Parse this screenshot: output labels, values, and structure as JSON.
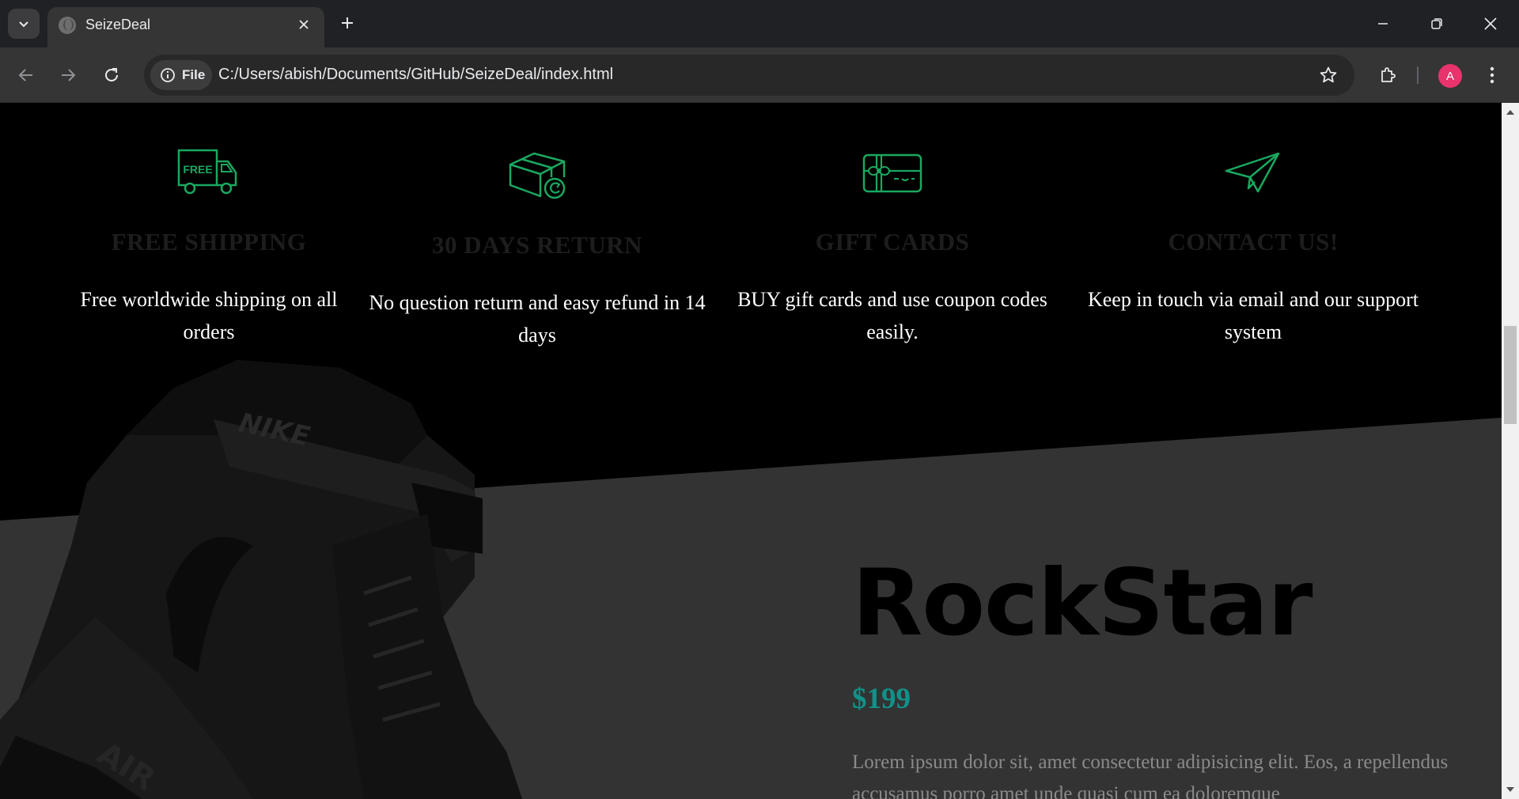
{
  "browser": {
    "tab_title": "SeizeDeal",
    "site_chip_label": "File",
    "url": "C:/Users/abish/Documents/GitHub/SeizeDeal/index.html",
    "profile_initial": "A",
    "profile_color": "#e8336d"
  },
  "features": [
    {
      "icon": "free-shipping-truck-icon",
      "title": "FREE SHIPPING",
      "text": "Free worldwide shipping on all orders"
    },
    {
      "icon": "return-box-icon",
      "title": "30 DAYS RETURN",
      "text": "No question return and easy refund in 14 days"
    },
    {
      "icon": "gift-card-icon",
      "title": "GIFT CARDS",
      "text": "BUY gift cards and use coupon codes easily."
    },
    {
      "icon": "paper-plane-icon",
      "title": "CONTACT US!",
      "text": "Keep in touch via email and our support system"
    }
  ],
  "product": {
    "name": "RockStar",
    "price": "$199",
    "description": "Lorem ipsum dolor sit, amet consectetur adipisicing elit. Eos, a repellendus accusamus porro amet unde quasi cum ea doloremque"
  },
  "colors": {
    "accent_green": "#1aa860",
    "price_teal": "#10928a",
    "section_dark": "#333333",
    "band_black": "#000000"
  }
}
